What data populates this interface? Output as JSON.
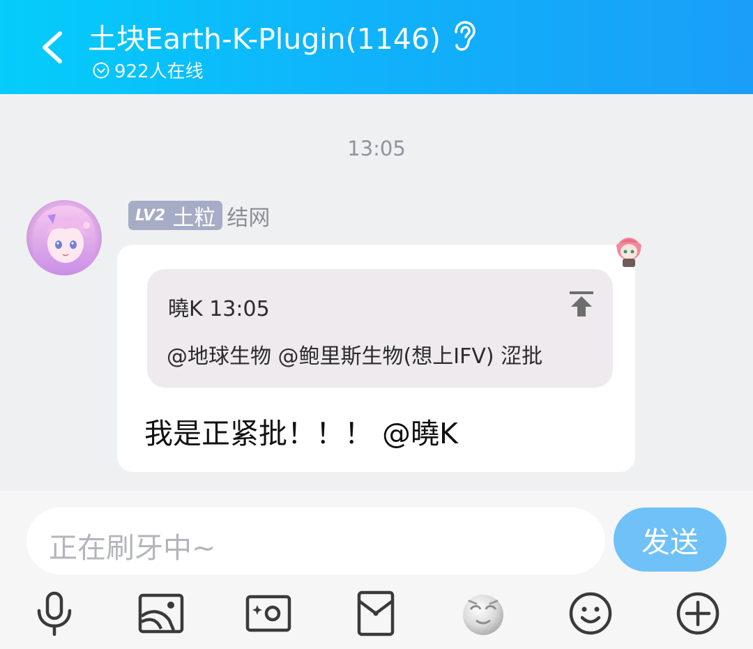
{
  "header": {
    "title": "土块Earth-K-Plugin(1146)",
    "online": "922人在线",
    "icons": {
      "back": "back-chevron-icon",
      "ear": "ear-icon",
      "online": "chevron-circle-icon"
    },
    "colors": {
      "gradient_start": "#04cdfa",
      "gradient_end": "#1a9ef8"
    }
  },
  "chat": {
    "timestamp": "13:05",
    "message": {
      "level_badge": "LV2",
      "member_title": "土粒",
      "sender": "结网",
      "quote": {
        "meta": "曉K 13:05",
        "text": "@地球生物 @鲍里斯生物(想上IFV) 涩批"
      },
      "text": "我是正紧批！！！ @曉K"
    }
  },
  "input": {
    "placeholder": "正在刷牙中~",
    "send_label": "发送",
    "send_color": "#6fc1f7"
  },
  "toolbar": [
    "mic-icon",
    "image-icon",
    "camera-icon",
    "red-envelope-icon",
    "sticker-face-icon",
    "emoji-icon",
    "plus-icon"
  ]
}
